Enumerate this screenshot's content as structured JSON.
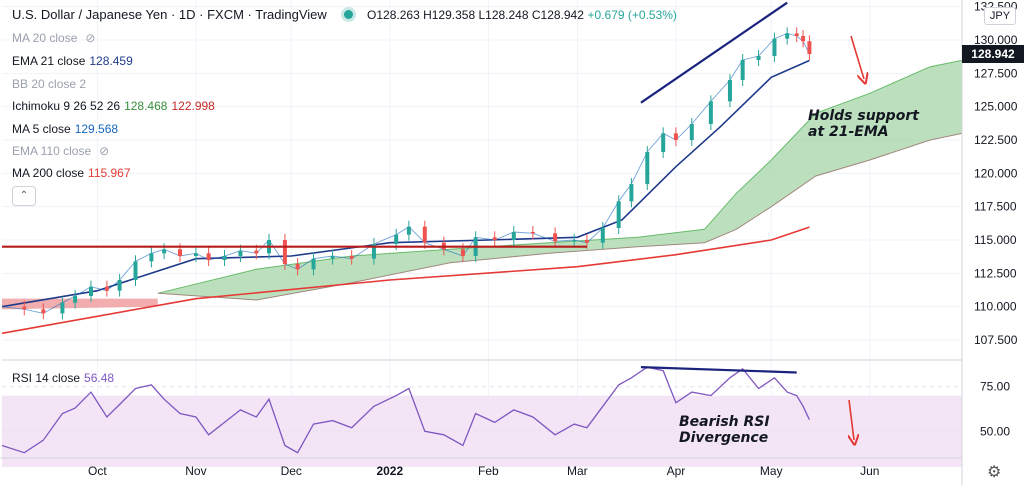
{
  "header": {
    "title": "U.S. Dollar / Japanese Yen · 1D · FXCM · TradingView",
    "ohlc": "O128.263  H129.358  L128.248  C128.942",
    "change": "+0.679 (+0.53%)"
  },
  "currency": "JPY",
  "legend": [
    {
      "label": "MA 20 close",
      "value": "",
      "hidden": true,
      "color": "#9aa0ad"
    },
    {
      "label": "EMA 21 close",
      "value": "128.459",
      "hidden": false,
      "color": "#1e3a8a"
    },
    {
      "label": "BB 20 close 2",
      "value": "",
      "hidden": false,
      "color": "#9aa0ad",
      "muted": true
    },
    {
      "label": "Ichimoku 9 26 52 26",
      "value": "128.468",
      "value2": "122.998",
      "hidden": false,
      "color": "#388e3c",
      "color2": "#c62828"
    },
    {
      "label": "MA 5 close",
      "value": "129.568",
      "hidden": false,
      "color": "#1565c0"
    },
    {
      "label": "EMA 110 close",
      "value": "",
      "hidden": true,
      "color": "#9aa0ad"
    },
    {
      "label": "MA 200 close",
      "value": "115.967",
      "hidden": false,
      "color": "#e53935"
    }
  ],
  "last_price": "128.942",
  "annotations": {
    "support": [
      "Holds support",
      "at 21-EMA"
    ],
    "rsi": [
      "Bearish RSI",
      "Divergence"
    ]
  },
  "rsi_label": {
    "label": "RSI 14 close",
    "value": "56.48"
  },
  "colors": {
    "up": "#26a69a",
    "down": "#ef5350",
    "ema21": "#1e3a8a",
    "ma5": "#1565c0",
    "ma200": "#e53935",
    "cloud_green": "#a5d6a7",
    "cloud_red": "#ef9a9a",
    "resistance": "#b71c1c",
    "trendline": "#1a237e",
    "arrow": "#e53935",
    "rsi_line": "#7e57c2",
    "rsi_band": "#f3e5f5"
  },
  "chart_data": [
    {
      "type": "candlestick",
      "title": "U.S. Dollar / Japanese Yen · 1D · FXCM · TradingView",
      "xlabel": "",
      "ylabel": "",
      "x_ticks": [
        "Oct",
        "Nov",
        "Dec",
        "2022",
        "Feb",
        "Mar",
        "Apr",
        "May",
        "Jun"
      ],
      "x_tick_dates": [
        "2021-10-01",
        "2021-11-01",
        "2021-12-01",
        "2022-01-01",
        "2022-02-01",
        "2022-03-01",
        "2022-04-01",
        "2022-05-01",
        "2022-06-01"
      ],
      "x_range": [
        "2021-09-01",
        "2022-06-30"
      ],
      "y_ticks": [
        107.5,
        110.0,
        112.5,
        115.0,
        117.5,
        120.0,
        122.5,
        125.0,
        127.5,
        130.0,
        132.5
      ],
      "ylim": [
        106.0,
        133.0
      ],
      "close": [
        [
          "2021-09-01",
          110.0
        ],
        [
          "2021-09-08",
          109.8
        ],
        [
          "2021-09-14",
          109.5
        ],
        [
          "2021-09-20",
          110.3
        ],
        [
          "2021-09-24",
          110.8
        ],
        [
          "2021-09-29",
          111.5
        ],
        [
          "2021-10-04",
          111.2
        ],
        [
          "2021-10-08",
          112.0
        ],
        [
          "2021-10-13",
          113.4
        ],
        [
          "2021-10-18",
          114.0
        ],
        [
          "2021-10-22",
          114.3
        ],
        [
          "2021-10-27",
          113.8
        ],
        [
          "2021-11-01",
          114.0
        ],
        [
          "2021-11-05",
          113.5
        ],
        [
          "2021-11-10",
          113.8
        ],
        [
          "2021-11-15",
          114.2
        ],
        [
          "2021-11-20",
          114.0
        ],
        [
          "2021-11-24",
          115.0
        ],
        [
          "2021-11-29",
          113.2
        ],
        [
          "2021-12-03",
          112.8
        ],
        [
          "2021-12-08",
          113.6
        ],
        [
          "2021-12-14",
          113.8
        ],
        [
          "2021-12-20",
          113.6
        ],
        [
          "2021-12-27",
          114.7
        ],
        [
          "2022-01-03",
          115.4
        ],
        [
          "2022-01-07",
          116.0
        ],
        [
          "2022-01-12",
          114.8
        ],
        [
          "2022-01-18",
          114.3
        ],
        [
          "2022-01-24",
          113.8
        ],
        [
          "2022-01-28",
          115.2
        ],
        [
          "2022-02-03",
          115.0
        ],
        [
          "2022-02-09",
          115.6
        ],
        [
          "2022-02-15",
          115.5
        ],
        [
          "2022-02-22",
          114.9
        ],
        [
          "2022-02-28",
          115.0
        ],
        [
          "2022-03-04",
          114.8
        ],
        [
          "2022-03-09",
          115.9
        ],
        [
          "2022-03-14",
          117.9
        ],
        [
          "2022-03-18",
          119.2
        ],
        [
          "2022-03-23",
          121.6
        ],
        [
          "2022-03-28",
          123.0
        ],
        [
          "2022-04-01",
          122.5
        ],
        [
          "2022-04-06",
          123.7
        ],
        [
          "2022-04-12",
          125.4
        ],
        [
          "2022-04-18",
          127.0
        ],
        [
          "2022-04-22",
          128.5
        ],
        [
          "2022-04-27",
          128.8
        ],
        [
          "2022-05-02",
          130.1
        ],
        [
          "2022-05-06",
          130.5
        ],
        [
          "2022-05-09",
          130.3
        ],
        [
          "2022-05-11",
          129.9
        ],
        [
          "2022-05-13",
          128.942
        ]
      ],
      "ema21": [
        [
          "2021-09-01",
          110.0
        ],
        [
          "2021-10-01",
          111.2
        ],
        [
          "2021-11-01",
          113.6
        ],
        [
          "2021-12-01",
          113.8
        ],
        [
          "2022-01-01",
          114.8
        ],
        [
          "2022-02-01",
          115.0
        ],
        [
          "2022-03-01",
          115.2
        ],
        [
          "2022-03-15",
          116.5
        ],
        [
          "2022-04-01",
          120.5
        ],
        [
          "2022-04-15",
          123.5
        ],
        [
          "2022-05-01",
          127.2
        ],
        [
          "2022-05-13",
          128.459
        ]
      ],
      "ma200": [
        [
          "2021-09-01",
          108.0
        ],
        [
          "2021-11-01",
          110.6
        ],
        [
          "2022-01-01",
          112.0
        ],
        [
          "2022-03-01",
          113.0
        ],
        [
          "2022-04-01",
          113.9
        ],
        [
          "2022-05-01",
          115.0
        ],
        [
          "2022-05-13",
          115.967
        ]
      ],
      "ichimoku_cloud_top": [
        [
          "2021-10-20",
          111.0
        ],
        [
          "2021-11-20",
          112.8
        ],
        [
          "2021-12-20",
          113.8
        ],
        [
          "2022-01-20",
          114.3
        ],
        [
          "2022-02-20",
          114.8
        ],
        [
          "2022-03-20",
          115.2
        ],
        [
          "2022-04-10",
          115.8
        ],
        [
          "2022-04-20",
          118.5
        ],
        [
          "2022-05-01",
          121.0
        ],
        [
          "2022-05-15",
          124.5
        ],
        [
          "2022-06-01",
          126.0
        ],
        [
          "2022-06-20",
          128.0
        ],
        [
          "2022-06-30",
          128.468
        ]
      ],
      "ichimoku_cloud_bottom": [
        [
          "2021-10-20",
          111.0
        ],
        [
          "2021-11-20",
          110.5
        ],
        [
          "2021-12-20",
          111.8
        ],
        [
          "2022-01-20",
          113.3
        ],
        [
          "2022-02-20",
          114.0
        ],
        [
          "2022-03-20",
          114.5
        ],
        [
          "2022-04-10",
          114.8
        ],
        [
          "2022-04-20",
          115.8
        ],
        [
          "2022-05-01",
          117.5
        ],
        [
          "2022-05-15",
          119.8
        ],
        [
          "2022-06-01",
          121.0
        ],
        [
          "2022-06-20",
          122.5
        ],
        [
          "2022-06-30",
          122.998
        ]
      ],
      "resistance_level": 114.5,
      "resistance_range": [
        "2021-09-01",
        "2022-03-04"
      ],
      "trendline": [
        [
          "2022-03-21",
          125.3
        ],
        [
          "2022-05-06",
          132.8
        ]
      ],
      "last_price": 128.942
    },
    {
      "type": "line",
      "title": "RSI 14 close",
      "ylim": [
        35,
        90
      ],
      "y_ticks": [
        50.0,
        75.0
      ],
      "band": [
        30,
        70
      ],
      "values": [
        [
          "2021-09-01",
          42
        ],
        [
          "2021-09-08",
          38
        ],
        [
          "2021-09-14",
          45
        ],
        [
          "2021-09-20",
          60
        ],
        [
          "2021-09-24",
          63
        ],
        [
          "2021-09-29",
          72
        ],
        [
          "2021-10-04",
          58
        ],
        [
          "2021-10-08",
          65
        ],
        [
          "2021-10-13",
          74
        ],
        [
          "2021-10-18",
          76
        ],
        [
          "2021-10-22",
          68
        ],
        [
          "2021-10-27",
          60
        ],
        [
          "2021-11-01",
          58
        ],
        [
          "2021-11-05",
          48
        ],
        [
          "2021-11-10",
          55
        ],
        [
          "2021-11-15",
          62
        ],
        [
          "2021-11-20",
          58
        ],
        [
          "2021-11-24",
          68
        ],
        [
          "2021-11-29",
          42
        ],
        [
          "2021-12-03",
          38
        ],
        [
          "2021-12-08",
          54
        ],
        [
          "2021-12-14",
          56
        ],
        [
          "2021-12-20",
          52
        ],
        [
          "2021-12-27",
          64
        ],
        [
          "2022-01-03",
          70
        ],
        [
          "2022-01-07",
          74
        ],
        [
          "2022-01-12",
          50
        ],
        [
          "2022-01-18",
          48
        ],
        [
          "2022-01-24",
          42
        ],
        [
          "2022-01-28",
          60
        ],
        [
          "2022-02-03",
          55
        ],
        [
          "2022-02-09",
          62
        ],
        [
          "2022-02-15",
          58
        ],
        [
          "2022-02-22",
          48
        ],
        [
          "2022-02-28",
          54
        ],
        [
          "2022-03-04",
          52
        ],
        [
          "2022-03-09",
          64
        ],
        [
          "2022-03-14",
          76
        ],
        [
          "2022-03-18",
          80
        ],
        [
          "2022-03-23",
          86
        ],
        [
          "2022-03-28",
          84
        ],
        [
          "2022-04-01",
          66
        ],
        [
          "2022-04-06",
          72
        ],
        [
          "2022-04-12",
          70
        ],
        [
          "2022-04-18",
          80
        ],
        [
          "2022-04-22",
          85
        ],
        [
          "2022-04-27",
          74
        ],
        [
          "2022-05-02",
          80
        ],
        [
          "2022-05-06",
          72
        ],
        [
          "2022-05-09",
          70
        ],
        [
          "2022-05-11",
          64
        ],
        [
          "2022-05-13",
          56.48
        ]
      ],
      "divergence_line": [
        [
          "2022-03-21",
          86
        ],
        [
          "2022-05-09",
          83
        ]
      ],
      "last_value": 56.48
    }
  ]
}
